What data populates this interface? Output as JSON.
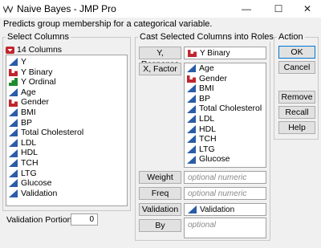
{
  "window": {
    "title": "Naive Bayes - JMP Pro",
    "subtitle": "Predicts group membership for a categorical variable.",
    "minimize": "—",
    "maximize": "☐",
    "close": "✕"
  },
  "colors": {
    "continuous": "#2b5ca8",
    "nominal": "#c0262d",
    "ordinal": "#1e8a2e"
  },
  "select_columns": {
    "group_label": "Select Columns",
    "count_label": "14 Columns",
    "items": [
      {
        "label": "Y",
        "icon": "continuous"
      },
      {
        "label": "Y Binary",
        "icon": "nominal"
      },
      {
        "label": "Y Ordinal",
        "icon": "ordinal"
      },
      {
        "label": "Age",
        "icon": "continuous"
      },
      {
        "label": "Gender",
        "icon": "nominal"
      },
      {
        "label": "BMI",
        "icon": "continuous"
      },
      {
        "label": "BP",
        "icon": "continuous"
      },
      {
        "label": "Total Cholesterol",
        "icon": "continuous"
      },
      {
        "label": "LDL",
        "icon": "continuous"
      },
      {
        "label": "HDL",
        "icon": "continuous"
      },
      {
        "label": "TCH",
        "icon": "continuous"
      },
      {
        "label": "LTG",
        "icon": "continuous"
      },
      {
        "label": "Glucose",
        "icon": "continuous"
      },
      {
        "label": "Validation",
        "icon": "continuous"
      }
    ]
  },
  "validation_portion": {
    "label": "Validation Portion",
    "value": "0"
  },
  "roles": {
    "group_label": "Cast Selected Columns into Roles",
    "y_response": {
      "button": "Y, Response",
      "value": "Y Binary",
      "icon": "nominal"
    },
    "x_factor": {
      "button": "X, Factor",
      "items": [
        {
          "label": "Age",
          "icon": "continuous"
        },
        {
          "label": "Gender",
          "icon": "nominal"
        },
        {
          "label": "BMI",
          "icon": "continuous"
        },
        {
          "label": "BP",
          "icon": "continuous"
        },
        {
          "label": "Total Cholesterol",
          "icon": "continuous"
        },
        {
          "label": "LDL",
          "icon": "continuous"
        },
        {
          "label": "HDL",
          "icon": "continuous"
        },
        {
          "label": "TCH",
          "icon": "continuous"
        },
        {
          "label": "LTG",
          "icon": "continuous"
        },
        {
          "label": "Glucose",
          "icon": "continuous"
        }
      ]
    },
    "weight": {
      "button": "Weight",
      "placeholder": "optional numeric"
    },
    "freq": {
      "button": "Freq",
      "placeholder": "optional numeric"
    },
    "validation": {
      "button": "Validation",
      "value": "Validation",
      "icon": "continuous"
    },
    "by": {
      "button": "By",
      "placeholder": "optional"
    }
  },
  "action": {
    "group_label": "Action",
    "ok": "OK",
    "cancel": "Cancel",
    "remove": "Remove",
    "recall": "Recall",
    "help": "Help"
  }
}
